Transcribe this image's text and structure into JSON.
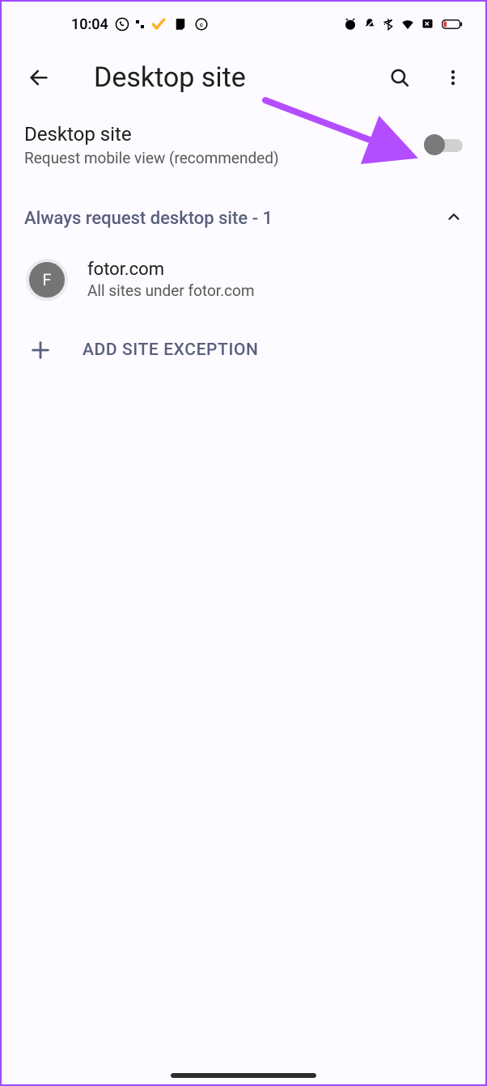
{
  "status": {
    "time": "10:04"
  },
  "header": {
    "title": "Desktop site"
  },
  "setting": {
    "title": "Desktop site",
    "subtitle": "Request mobile view (recommended)",
    "toggle_on": false
  },
  "section": {
    "title": "Always request desktop site - 1"
  },
  "sites": [
    {
      "initial": "F",
      "name": "fotor.com",
      "subtitle": "All sites under fotor.com"
    }
  ],
  "add": {
    "label": "ADD SITE EXCEPTION"
  }
}
